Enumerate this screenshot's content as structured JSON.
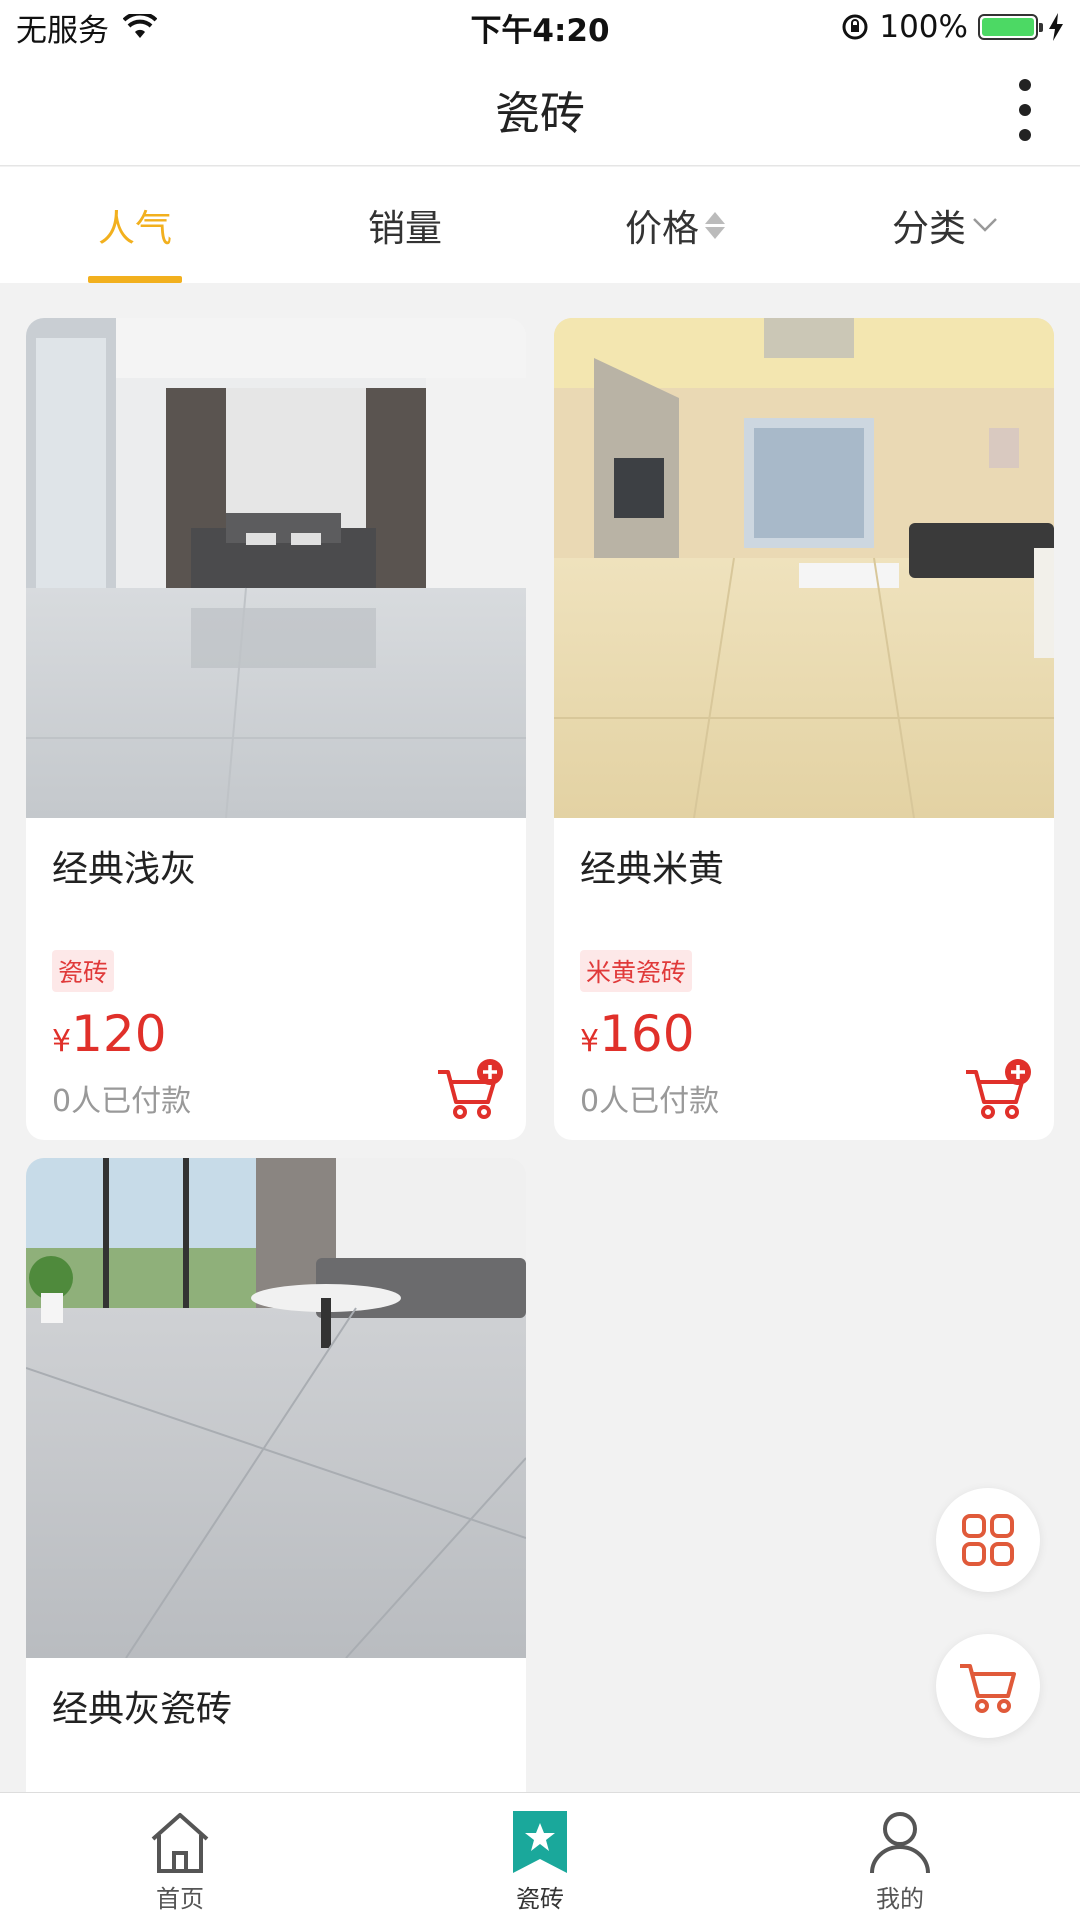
{
  "status_bar": {
    "carrier": "无服务",
    "time": "下午4:20",
    "battery": "100%"
  },
  "nav": {
    "title": "瓷砖"
  },
  "sort_tabs": [
    {
      "label": "人气",
      "active": true
    },
    {
      "label": "销量",
      "active": false
    },
    {
      "label": "价格",
      "active": false
    },
    {
      "label": "分类",
      "active": false
    }
  ],
  "products": [
    {
      "title": "经典浅灰",
      "tag": "瓷砖",
      "currency": "¥",
      "price": "120",
      "sold": "0人已付款"
    },
    {
      "title": "经典米黄",
      "tag": "米黄瓷砖",
      "currency": "¥",
      "price": "160",
      "sold": "0人已付款"
    },
    {
      "title": "经典灰瓷砖"
    }
  ],
  "tab_bar": [
    {
      "label": "首页",
      "icon": "home-icon"
    },
    {
      "label": "瓷砖",
      "icon": "star-bookmark-icon"
    },
    {
      "label": "我的",
      "icon": "user-icon"
    }
  ],
  "colors": {
    "accent": "#f2b01e",
    "price": "#e0302a",
    "tab_active": "#1aa89b",
    "fab_icon": "#e05a3a"
  }
}
